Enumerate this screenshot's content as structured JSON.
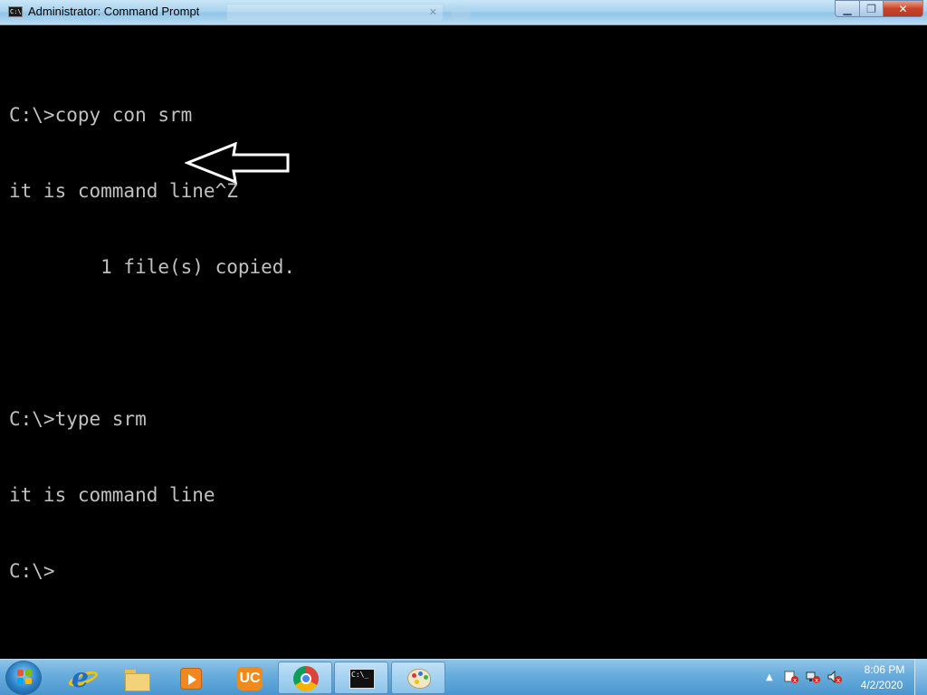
{
  "window": {
    "title": "Administrator: Command Prompt",
    "icon": "cmd-icon",
    "controls": [
      "minimize-icon",
      "maximize-icon",
      "close-icon"
    ]
  },
  "console": {
    "lines": [
      "C:\\>copy con srm",
      "it is command line^Z",
      "        1 file(s) copied.",
      "",
      "C:\\>type srm",
      "it is command line",
      "C:\\>"
    ],
    "text_color": "#c0c0c0",
    "background": "#000000",
    "annotation": "arrow-icon"
  },
  "taskbar": {
    "start": "windows-logo-icon",
    "pinned": [
      "internet-explorer-icon",
      "file-explorer-icon",
      "media-player-icon",
      "uc-browser-icon",
      "chrome-icon",
      "command-prompt-icon",
      "paint-icon"
    ],
    "tray_icons": [
      "show-hidden-icons-icon",
      "action-center-error-icon",
      "network-error-icon",
      "volume-muted-icon"
    ],
    "clock": {
      "time": "8:06 PM",
      "date": "4/2/2020"
    }
  }
}
